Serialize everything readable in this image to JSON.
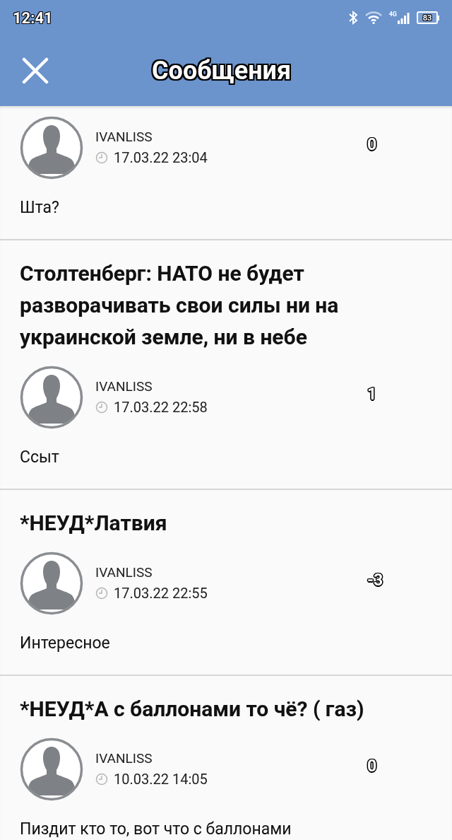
{
  "status_bar": {
    "time": "12:41",
    "network": "4G",
    "battery": "83"
  },
  "header": {
    "title": "Сообщения"
  },
  "messages": [
    {
      "author": "IVANLISS",
      "time": "17.03.22 23:04",
      "score": "0",
      "body": "Шта?"
    },
    {
      "title": "Столтенберг: НАТО не будет разворачивать свои силы ни на украинской земле, ни в небе",
      "author": "IVANLISS",
      "time": "17.03.22 22:58",
      "score": "1",
      "body": "Ссыт"
    },
    {
      "title": "*НЕУД*Латвия",
      "author": "IVANLISS",
      "time": "17.03.22 22:55",
      "score": "-3",
      "body": "Интересное"
    },
    {
      "title": "*НЕУД*А с баллонами то чё? ( газ)",
      "author": "IVANLISS",
      "time": "10.03.22 14:05",
      "score": "0",
      "body": "Пиздит кто то, вот что с баллонами"
    }
  ]
}
